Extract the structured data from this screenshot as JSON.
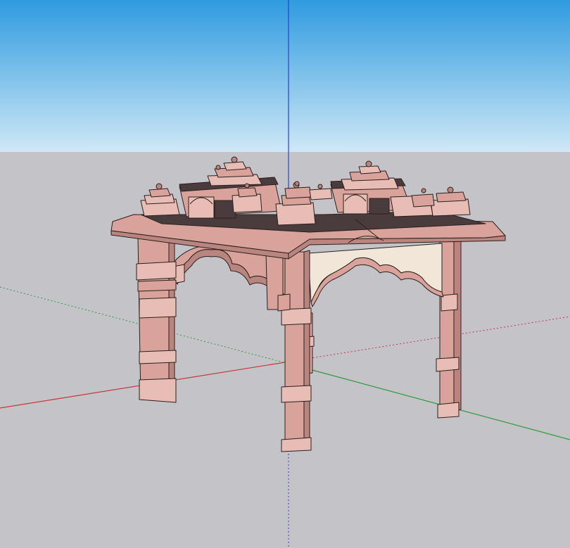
{
  "viewport": {
    "model": "pavilion",
    "colors": {
      "sky_top": "#2f9be0",
      "sky_bottom": "#cfe8f6",
      "ground": "#c4c4c8",
      "model_fill": "#d9a39b",
      "model_light": "#e8bdb5",
      "model_dark": "#b9857e",
      "edge": "#2a1f1f",
      "glass": "#f1e6d8",
      "roof_shadow": "#4a3c3c",
      "axis_red": "#c0393b",
      "axis_green": "#2e9a3c",
      "axis_blue": "#2c3fd0"
    }
  }
}
